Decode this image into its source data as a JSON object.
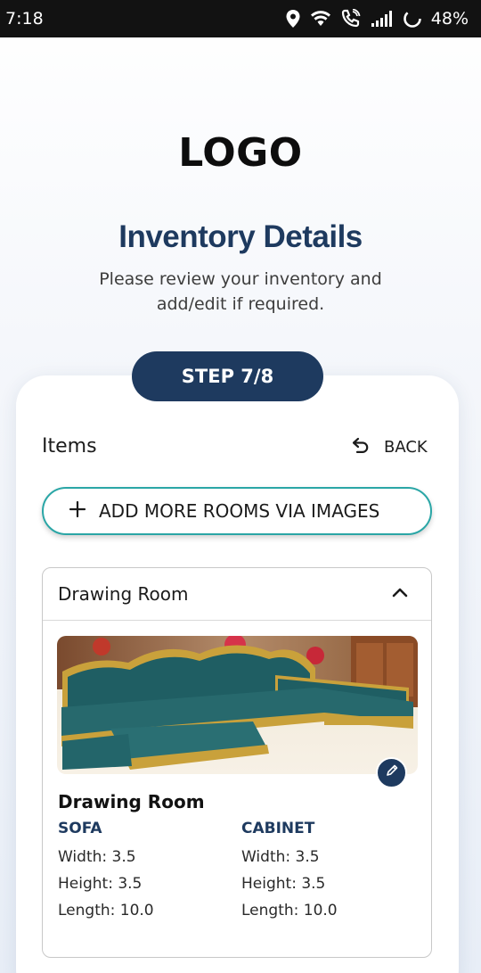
{
  "status_bar": {
    "time": "7:18",
    "battery": "48%",
    "icons": [
      "location-icon",
      "wifi-icon",
      "wifi-calling-icon",
      "signal-icon",
      "battery-saver-icon"
    ]
  },
  "header": {
    "logo_text": "LOGO",
    "title": "Inventory Details",
    "subtitle": "Please review your inventory and add/edit if required."
  },
  "step": {
    "label": "STEP 7/8"
  },
  "items_section": {
    "title": "Items",
    "back_label": "BACK",
    "add_rooms_label": "ADD MORE ROOMS VIA IMAGES"
  },
  "rooms": [
    {
      "header": "Drawing Room",
      "name": "Drawing Room",
      "items": [
        {
          "name": "SOFA",
          "width": "Width: 3.5",
          "height": "Height: 3.5",
          "length": "Length: 10.0"
        },
        {
          "name": "CABINET",
          "width": "Width: 3.5",
          "height": "Height: 3.5",
          "length": "Length: 10.0"
        }
      ]
    }
  ],
  "colors": {
    "primary": "#1e3a5f",
    "accent_border": "#2aa6a6",
    "status_bar": "#121212"
  }
}
